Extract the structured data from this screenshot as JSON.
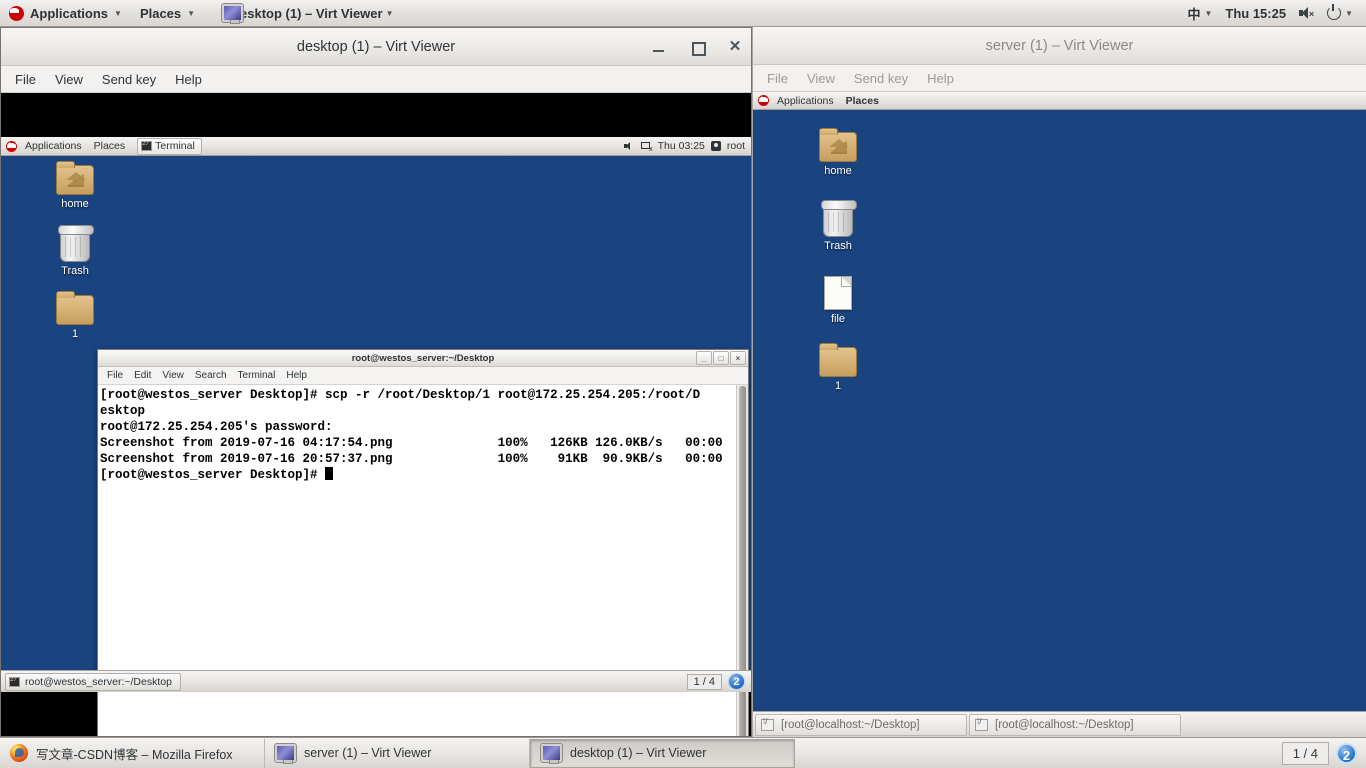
{
  "top_panel": {
    "applications": "Applications",
    "places": "Places",
    "window_item": "desktop (1) – Virt Viewer",
    "input_method": "中",
    "clock": "Thu 15:25",
    "icons": {
      "redhat": "redhat-icon",
      "monitor": "monitor-icon",
      "speaker": "speaker-muted-icon",
      "power": "power-icon"
    }
  },
  "left_window": {
    "title": "desktop (1) – Virt Viewer",
    "menu": [
      "File",
      "View",
      "Send key",
      "Help"
    ],
    "guest_panel": {
      "applications": "Applications",
      "places": "Places",
      "task": "Terminal",
      "clock": "Thu 03:25",
      "user": "root"
    },
    "desktop_icons": [
      {
        "label": "home",
        "icon": "home-folder-icon"
      },
      {
        "label": "Trash",
        "icon": "trash-icon"
      },
      {
        "label": "1",
        "icon": "folder-icon"
      }
    ],
    "taskbar": {
      "task": "root@westos_server:~/Desktop",
      "workspace": "1 / 4",
      "badge": "2"
    }
  },
  "terminal": {
    "title": "root@westos_server:~/Desktop",
    "menu": [
      "File",
      "Edit",
      "View",
      "Search",
      "Terminal",
      "Help"
    ],
    "lines": [
      "[root@westos_server Desktop]# scp -r /root/Desktop/1 root@172.25.254.205:/root/D",
      "esktop",
      "root@172.25.254.205's password:",
      "Screenshot from 2019-07-16 04:17:54.png              100%   126KB 126.0KB/s   00:00",
      "Screenshot from 2019-07-16 20:57:37.png              100%    91KB  90.9KB/s   00:00",
      "[root@westos_server Desktop]# "
    ],
    "buttons": {
      "minimize": "_",
      "maximize": "□",
      "close": "×"
    }
  },
  "right_window": {
    "title": "server (1) – Virt Viewer",
    "menu": [
      "File",
      "View",
      "Send key",
      "Help"
    ],
    "guest_panel": {
      "applications": "Applications",
      "places": "Places"
    },
    "desktop_icons": [
      {
        "label": "home",
        "icon": "home-folder-icon"
      },
      {
        "label": "Trash",
        "icon": "trash-icon"
      },
      {
        "label": "file",
        "icon": "file-icon"
      },
      {
        "label": "1",
        "icon": "folder-icon"
      }
    ],
    "taskbar_items": [
      "[root@localhost:~/Desktop]",
      "[root@localhost:~/Desktop]"
    ]
  },
  "bottom_panel": {
    "tasks": [
      {
        "label": "写文章-CSDN博客 – Mozilla Firefox",
        "icon": "firefox-icon",
        "active": false
      },
      {
        "label": "server (1) – Virt Viewer",
        "icon": "monitor-icon",
        "active": false
      },
      {
        "label": "desktop (1) – Virt Viewer",
        "icon": "monitor-icon",
        "active": true
      }
    ],
    "workspace": "1 / 4",
    "badge": "2"
  },
  "colors": {
    "desktop_blue": "#1a4480",
    "panel_gray": "#e7e4e1",
    "accent_blue": "#2a78c8"
  }
}
